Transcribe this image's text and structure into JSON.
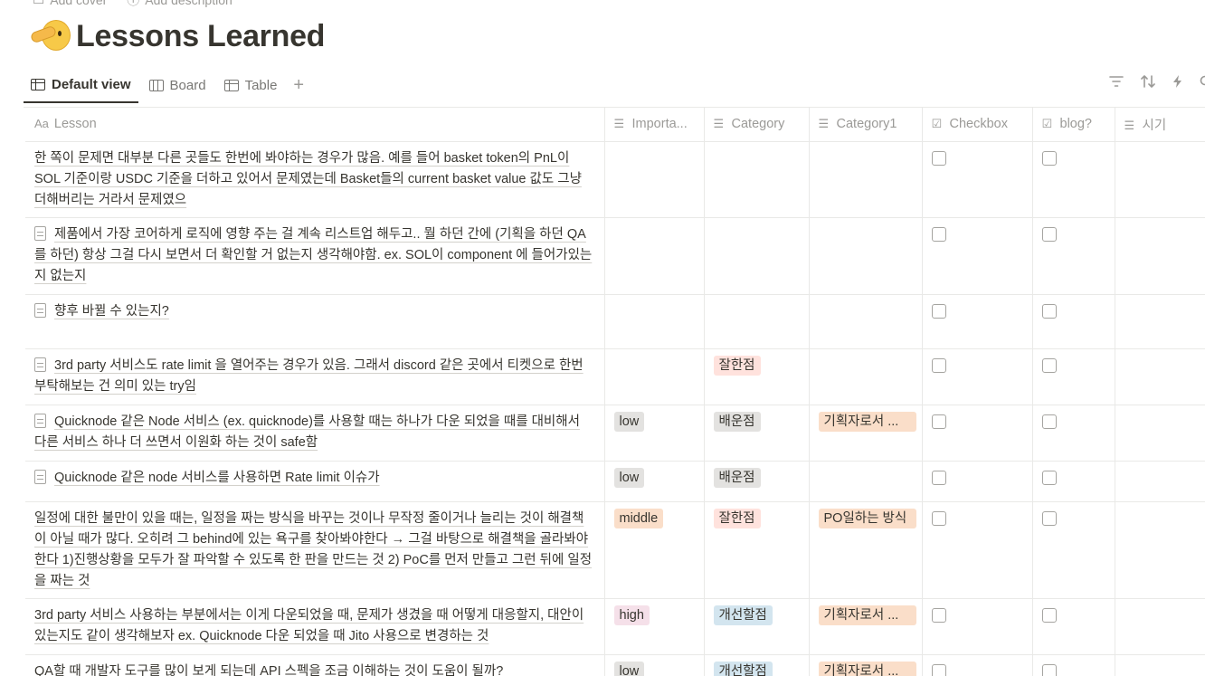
{
  "top_actions": {
    "add_cover": "Add cover",
    "add_description": "Add description"
  },
  "page": {
    "title": "Lessons Learned",
    "icon": "pointing-hand-face-emoji"
  },
  "tabs": [
    {
      "label": "Default view",
      "icon": "table-icon",
      "active": true
    },
    {
      "label": "Board",
      "icon": "board-icon",
      "active": false
    },
    {
      "label": "Table",
      "icon": "table-icon",
      "active": false
    }
  ],
  "add_view": "+",
  "toolbar": {
    "filter": "filter-icon",
    "sort": "sort-icon",
    "automation": "lightning-icon"
  },
  "columns": [
    {
      "label": "Lesson",
      "icon": "Aa"
    },
    {
      "label": "Importa...",
      "icon": "list-icon"
    },
    {
      "label": "Category",
      "icon": "list-icon"
    },
    {
      "label": "Category1",
      "icon": "list-icon"
    },
    {
      "label": "Checkbox",
      "icon": "checkbox-icon"
    },
    {
      "label": "blog?",
      "icon": "checkbox-icon"
    },
    {
      "label": "시기",
      "icon": "list-icon"
    }
  ],
  "tag_colors": {
    "low": "#e3e2e0",
    "middle": "#fadec9",
    "high": "#f5e0e9",
    "잘한점": "#ffe2dd",
    "배운점": "#e3e2e0",
    "개선할점": "#d3e5ef",
    "기획자로서": "#fadec9",
    "PO일하는": "#fadec9"
  },
  "rows": [
    {
      "lesson": "한 쪽이 문제면 대부분 다른 곳들도 한번에 봐야하는 경우가 많음. 예를 들어 basket token의 PnL이 SOL 기준이랑 USDC 기준을 더하고 있어서 문제였는데 Basket들의 current basket value 값도 그냥 더해버리는 거라서 문제였으",
      "doc": false,
      "importance": "",
      "category": "",
      "category1": ""
    },
    {
      "lesson": "제품에서 가장 코어하게 로직에 영향 주는 걸 계속 리스트업 해두고.. 뭘 하던 간에 (기획을 하던 QA를 하던) 항상 그걸 다시 보면서 더 확인할 거 없는지 생각해야함. ex. SOL이 component 에 들어가있는지 없는지",
      "doc": true,
      "importance": "",
      "category": "",
      "category1": ""
    },
    {
      "lesson": "향후 바뀔 수 있는지?",
      "doc": true,
      "importance": "",
      "category": "",
      "category1": ""
    },
    {
      "lesson": "3rd party 서비스도 rate limit 을 열어주는 경우가 있음. 그래서 discord 같은 곳에서 티켓으로 한번 부탁해보는 건 의미 있는 try임",
      "doc": true,
      "importance": "",
      "category": "잘한점",
      "category1": ""
    },
    {
      "lesson": "Quicknode 같은 Node 서비스 (ex. quicknode)를 사용할 때는 하나가 다운 되었을 때를 대비해서 다른 서비스 하나 더 쓰면서 이원화 하는 것이 safe함",
      "doc": true,
      "importance": "low",
      "category": "배운점",
      "category1": "기획자로서 ..."
    },
    {
      "lesson": "Quicknode 같은 node 서비스를 사용하면 Rate limit 이슈가",
      "doc": true,
      "importance": "low",
      "category": "배운점",
      "category1": ""
    },
    {
      "lesson": "일정에 대한 불만이 있을 때는, 일정을 짜는 방식을 바꾸는 것이나 무작정 줄이거나 늘리는 것이 해결책이 아닐 때가 많다. 오히려 그 behind에 있는 욕구를 찾아봐야한다 → 그걸 바탕으로 해결책을 골라봐야한다 1)진행상황을 모두가 잘 파악할 수 있도록 한 판을 만드는 것 2)  PoC를 먼저 만들고 그런 뒤에 일정을 짜는 것",
      "doc": false,
      "importance": "middle",
      "category": "잘한점",
      "category1": "PO일하는 방식"
    },
    {
      "lesson": "3rd party 서비스 사용하는 부분에서는 이게 다운되었을 때, 문제가 생겼을 때 어떻게 대응할지, 대안이 있는지도 같이 생각해보자 ex. Quicknode 다운 되었을 때 Jito 사용으로 변경하는 것",
      "doc": false,
      "importance": "high",
      "category": "개선할점",
      "category1": "기획자로서 ..."
    },
    {
      "lesson": "QA할 때 개발자 도구를 많이 보게 되는데  API 스펙을 조금 이해하는 것이 도움이 될까?",
      "doc": false,
      "importance": "low",
      "category": "개선할점",
      "category1": "기획자로서 ..."
    }
  ]
}
